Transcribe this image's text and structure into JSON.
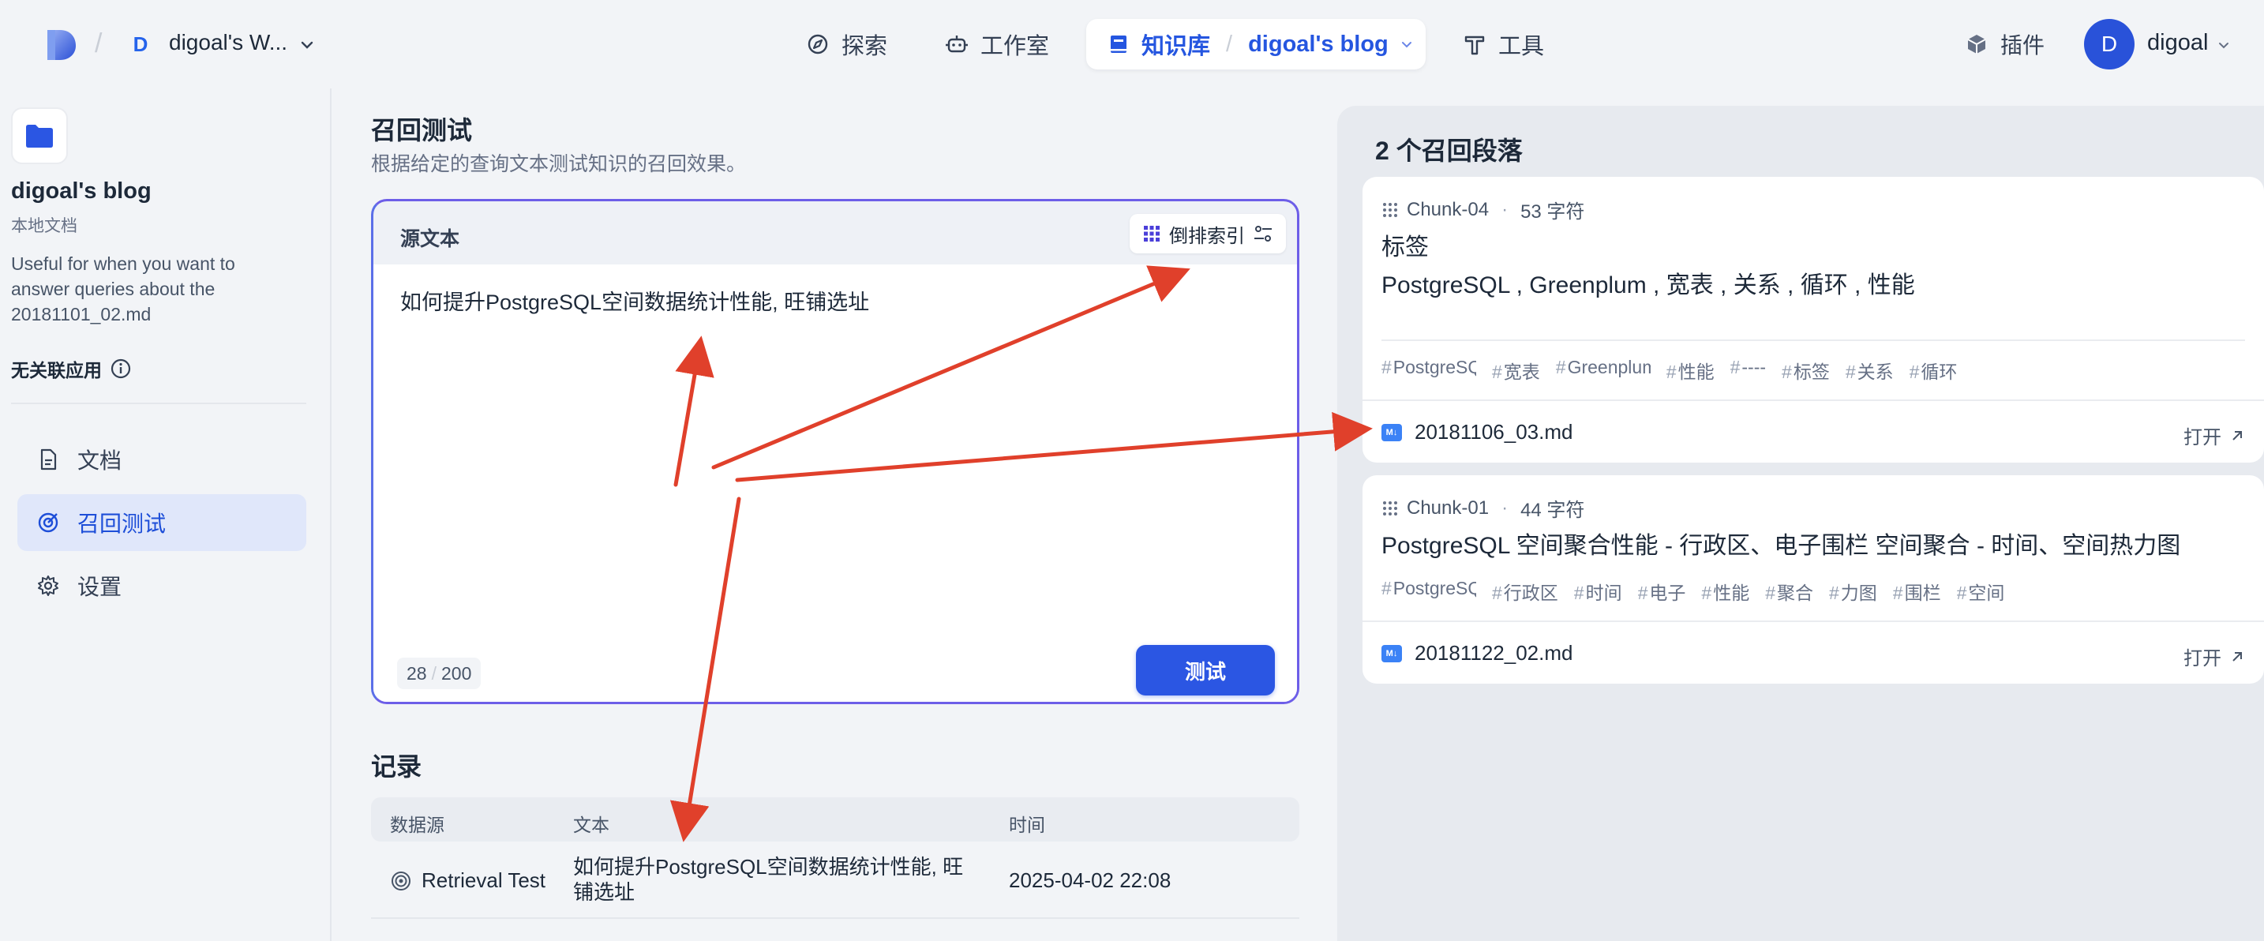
{
  "topbar": {
    "workspace_badge": "D",
    "workspace_name": "digoal's W...",
    "nav": [
      {
        "label": "探索",
        "icon": "compass-icon"
      },
      {
        "label": "工作室",
        "icon": "robot-icon"
      },
      {
        "label": "工具",
        "icon": "hammer-icon"
      }
    ],
    "active_nav_label": "知识库",
    "active_nav_dataset": "digoal's blog",
    "plugin_label": "插件",
    "user_initial": "D",
    "user_name": "digoal"
  },
  "sidebar": {
    "kb_title": "digoal's blog",
    "kb_subtitle": "本地文档",
    "kb_description": "Useful for when you want to answer queries about the 20181101_02.md",
    "apps_label": "无关联应用",
    "menu": [
      {
        "label": "文档",
        "icon": "document-icon"
      },
      {
        "label": "召回测试",
        "icon": "target-icon"
      },
      {
        "label": "设置",
        "icon": "gear-icon"
      }
    ]
  },
  "main": {
    "title": "召回测试",
    "description": "根据给定的查询文本测试知识的召回效果。",
    "source_label": "源文本",
    "index_button": "倒排索引",
    "query": "如何提升PostgreSQL空间数据统计性能, 旺铺选址",
    "count_current": "28",
    "count_max": "200",
    "test_button": "测试",
    "records_title": "记录",
    "records_headers": [
      "数据源",
      "文本",
      "时间"
    ],
    "records": [
      {
        "source": "Retrieval Test",
        "text": "如何提升PostgreSQL空间数据统计性能, 旺铺选址",
        "time": "2025-04-02 22:08"
      }
    ]
  },
  "results": {
    "title": "2 个召回段落",
    "open_label": "打开",
    "chunks": [
      {
        "id": "Chunk-04",
        "chars": "53 字符",
        "line1": "标签",
        "line2": "PostgreSQL , Greenplum , 宽表 , 关系 , 循环 , 性能",
        "tags": [
          "PostgreSQL",
          "宽表",
          "Greenplum",
          "性能",
          "----",
          "标签",
          "关系",
          "循环"
        ],
        "file": "20181106_03.md"
      },
      {
        "id": "Chunk-01",
        "chars": "44 字符",
        "line1": "PostgreSQL 空间聚合性能 - 行政区、电子围栏 空间聚合 - 时间、空间热力图",
        "tags": [
          "PostgreSQL",
          "行政区",
          "时间",
          "电子",
          "性能",
          "聚合",
          "力图",
          "围栏",
          "空间"
        ],
        "file": "20181122_02.md"
      }
    ]
  },
  "colors": {
    "accent": "#2b56e3",
    "annotation_arrow": "#e0402b"
  }
}
